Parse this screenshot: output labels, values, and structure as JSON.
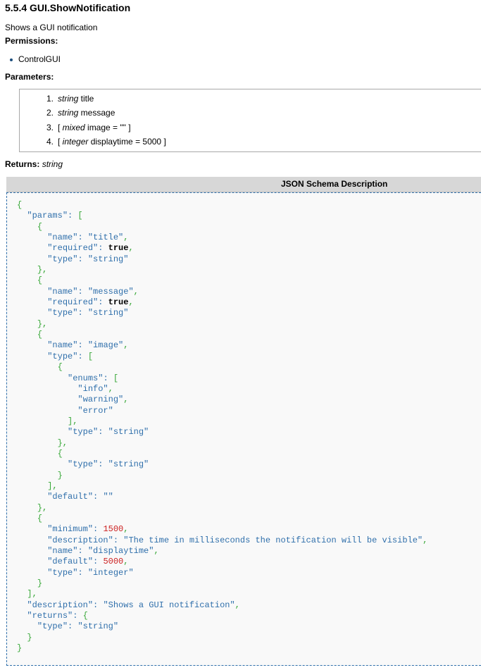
{
  "heading": "5.5.4 GUI.ShowNotification",
  "description": "Shows a GUI notification",
  "permissions": {
    "label": "Permissions:",
    "items": [
      "ControlGUI"
    ]
  },
  "parameters": {
    "label": "Parameters:",
    "items": [
      {
        "num": "1.",
        "type": "string",
        "name": "title",
        "optional": false,
        "default": ""
      },
      {
        "num": "2.",
        "type": "string",
        "name": "message",
        "optional": false,
        "default": ""
      },
      {
        "num": "3.",
        "type": "mixed",
        "name": "image",
        "optional": true,
        "default": "\"\""
      },
      {
        "num": "4.",
        "type": "integer",
        "name": "displaytime",
        "optional": true,
        "default": "5000"
      }
    ]
  },
  "returns": {
    "label": "Returns:",
    "type": "string"
  },
  "schema": {
    "header": "JSON Schema Description",
    "params": [
      {
        "name": "title",
        "required": "true",
        "type": "string"
      },
      {
        "name": "message",
        "required": "true",
        "type": "string"
      },
      {
        "name": "image",
        "enums": [
          "info",
          "warning",
          "error"
        ],
        "enum_type": "string",
        "alt_type": "string",
        "default": ""
      },
      {
        "minimum": "1500",
        "description": "The time in milliseconds the notification will be visible",
        "name": "displaytime",
        "default": "5000",
        "type": "integer"
      }
    ],
    "description": "Shows a GUI notification",
    "returns_type": "string"
  },
  "colors": {
    "punct": "#39a839",
    "key": "#2f6fab",
    "number": "#cc2222",
    "header_bg": "#d7d7d7",
    "body_border": "#2f6fab"
  }
}
